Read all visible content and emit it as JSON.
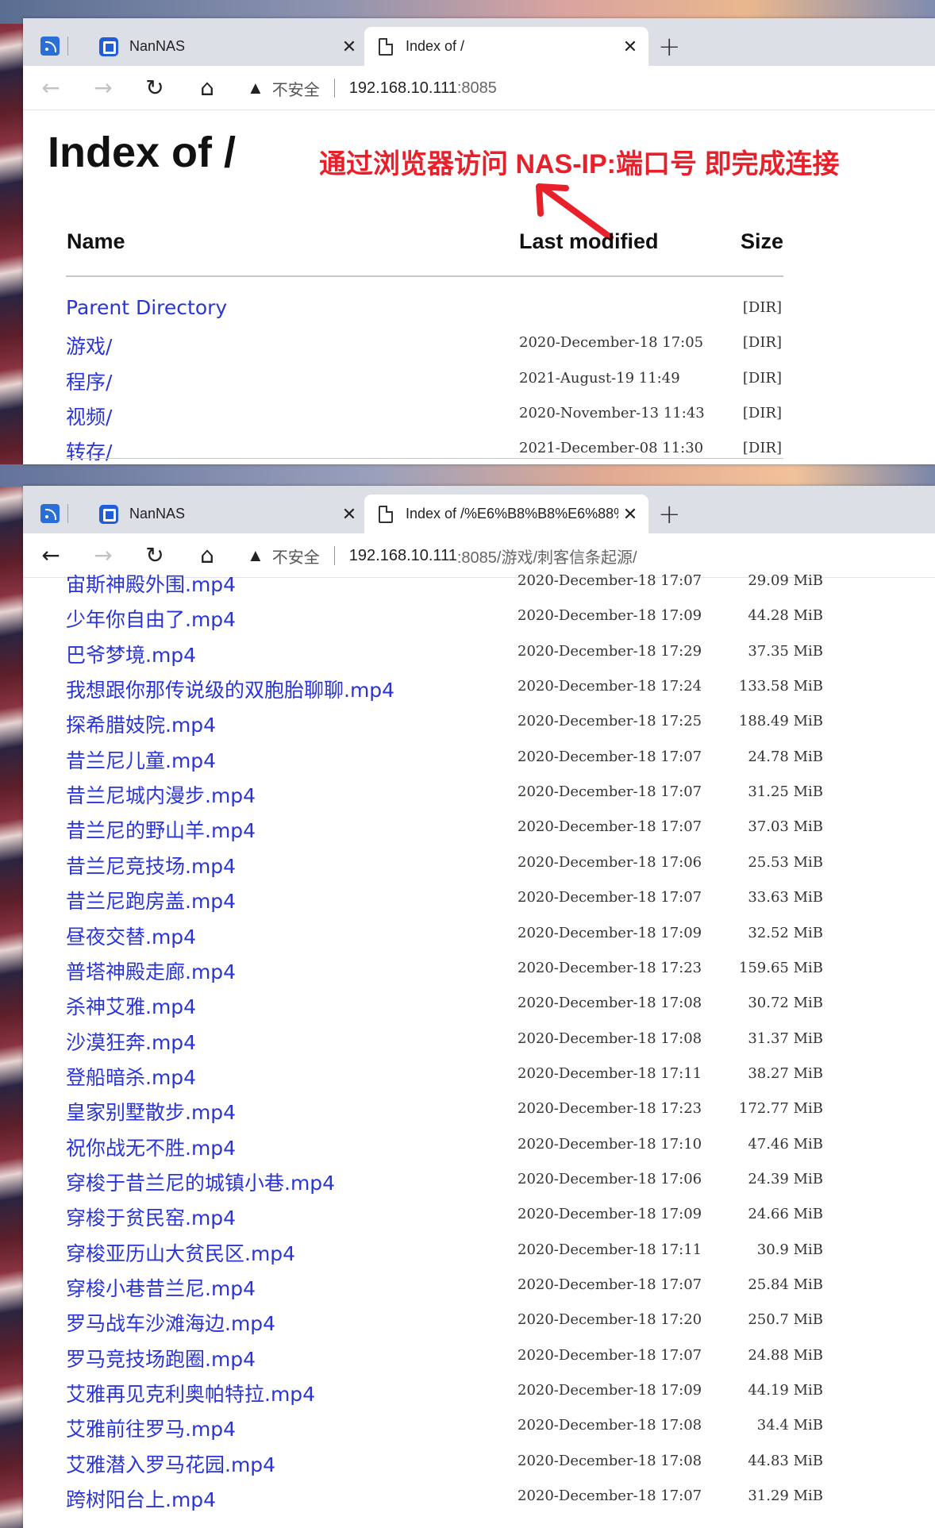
{
  "windows": [
    {
      "tabs": [
        {
          "label": "NanNAS"
        },
        {
          "label": "Index of /"
        }
      ],
      "url": {
        "insecure_label": "不安全",
        "host": "192.168.10.111",
        "rest": ":8085"
      },
      "page": {
        "title": "Index of /",
        "annotation": "通过浏览器访问 NAS-IP:端口号 即完成连接",
        "columns": {
          "name": "Name",
          "modified": "Last modified",
          "size": "Size"
        },
        "rows": [
          {
            "name": "Parent Directory",
            "modified": "",
            "size": "[DIR]"
          },
          {
            "name": "游戏/",
            "modified": "2020-December-18 17:05",
            "size": "[DIR]"
          },
          {
            "name": "程序/",
            "modified": "2021-August-19 11:49",
            "size": "[DIR]"
          },
          {
            "name": "视频/",
            "modified": "2020-November-13 11:43",
            "size": "[DIR]"
          },
          {
            "name": "转存/",
            "modified": "2021-December-08 11:30",
            "size": "[DIR]"
          }
        ]
      }
    },
    {
      "tabs": [
        {
          "label": "NanNAS"
        },
        {
          "label": "Index of /%E6%B8%B8%E6%88%"
        }
      ],
      "url": {
        "insecure_label": "不安全",
        "host": "192.168.10.111",
        "rest": ":8085/游戏/刺客信条起源/"
      },
      "page": {
        "rows": [
          {
            "name": "宙斯神殿外围.mp4",
            "modified": "2020-December-18 17:07",
            "size": "29.09 MiB"
          },
          {
            "name": "少年你自由了.mp4",
            "modified": "2020-December-18 17:09",
            "size": "44.28 MiB"
          },
          {
            "name": "巴爷梦境.mp4",
            "modified": "2020-December-18 17:29",
            "size": "37.35 MiB"
          },
          {
            "name": "我想跟你那传说级的双胞胎聊聊.mp4",
            "modified": "2020-December-18 17:24",
            "size": "133.58 MiB"
          },
          {
            "name": "探希腊妓院.mp4",
            "modified": "2020-December-18 17:25",
            "size": "188.49 MiB"
          },
          {
            "name": "昔兰尼儿童.mp4",
            "modified": "2020-December-18 17:07",
            "size": "24.78 MiB"
          },
          {
            "name": "昔兰尼城内漫步.mp4",
            "modified": "2020-December-18 17:07",
            "size": "31.25 MiB"
          },
          {
            "name": "昔兰尼的野山羊.mp4",
            "modified": "2020-December-18 17:07",
            "size": "37.03 MiB"
          },
          {
            "name": "昔兰尼竞技场.mp4",
            "modified": "2020-December-18 17:06",
            "size": "25.53 MiB"
          },
          {
            "name": "昔兰尼跑房盖.mp4",
            "modified": "2020-December-18 17:07",
            "size": "33.63 MiB"
          },
          {
            "name": "昼夜交替.mp4",
            "modified": "2020-December-18 17:09",
            "size": "32.52 MiB"
          },
          {
            "name": "普塔神殿走廊.mp4",
            "modified": "2020-December-18 17:23",
            "size": "159.65 MiB"
          },
          {
            "name": "杀神艾雅.mp4",
            "modified": "2020-December-18 17:08",
            "size": "30.72 MiB"
          },
          {
            "name": "沙漠狂奔.mp4",
            "modified": "2020-December-18 17:08",
            "size": "31.37 MiB"
          },
          {
            "name": "登船暗杀.mp4",
            "modified": "2020-December-18 17:11",
            "size": "38.27 MiB"
          },
          {
            "name": "皇家别墅散步.mp4",
            "modified": "2020-December-18 17:23",
            "size": "172.77 MiB"
          },
          {
            "name": "祝你战无不胜.mp4",
            "modified": "2020-December-18 17:10",
            "size": "47.46 MiB"
          },
          {
            "name": "穿梭于昔兰尼的城镇小巷.mp4",
            "modified": "2020-December-18 17:06",
            "size": "24.39 MiB"
          },
          {
            "name": "穿梭于贫民窑.mp4",
            "modified": "2020-December-18 17:09",
            "size": "24.66 MiB"
          },
          {
            "name": "穿梭亚历山大贫民区.mp4",
            "modified": "2020-December-18 17:11",
            "size": "30.9 MiB"
          },
          {
            "name": "穿梭小巷昔兰尼.mp4",
            "modified": "2020-December-18 17:07",
            "size": "25.84 MiB"
          },
          {
            "name": "罗马战车沙滩海边.mp4",
            "modified": "2020-December-18 17:20",
            "size": "250.7 MiB"
          },
          {
            "name": "罗马竞技场跑圈.mp4",
            "modified": "2020-December-18 17:07",
            "size": "24.88 MiB"
          },
          {
            "name": "艾雅再见克利奥帕特拉.mp4",
            "modified": "2020-December-18 17:09",
            "size": "44.19 MiB"
          },
          {
            "name": "艾雅前往罗马.mp4",
            "modified": "2020-December-18 17:08",
            "size": "34.4 MiB"
          },
          {
            "name": "艾雅潜入罗马花园.mp4",
            "modified": "2020-December-18 17:08",
            "size": "44.83 MiB"
          },
          {
            "name": "跨树阳台上.mp4",
            "modified": "2020-December-18 17:07",
            "size": "31.29 MiB"
          }
        ]
      }
    }
  ],
  "colors": {
    "link": "#2a35d4",
    "annotation": "#e8202a",
    "accent": "#1f5ed8"
  },
  "icons": [
    "feed-icon",
    "nas-app-icon",
    "page-icon",
    "close-icon",
    "new-tab-icon",
    "back-icon",
    "forward-icon",
    "reload-icon",
    "home-icon",
    "warning-icon",
    "red-arrow-icon"
  ]
}
